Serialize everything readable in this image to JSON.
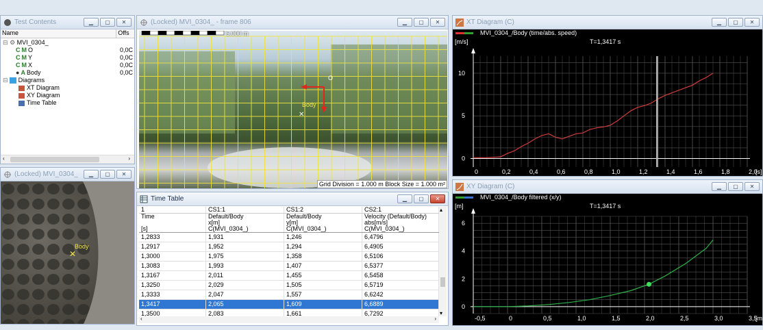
{
  "test_contents": {
    "title": "Test Contents",
    "col_name": "Name",
    "col_offset": "Offs",
    "root": "MVI_0304_",
    "items": [
      {
        "prefix": "C",
        "badge": "M",
        "label": "O",
        "value": "0,0C"
      },
      {
        "prefix": "C",
        "badge": "M",
        "label": "Y",
        "value": "0,0C"
      },
      {
        "prefix": "C",
        "badge": "M",
        "label": "X",
        "value": "0,0C"
      },
      {
        "prefix": "",
        "badge": "A",
        "label": "Body",
        "value": "0,0C"
      }
    ],
    "diagrams_label": "Diagrams",
    "diagram_items": [
      "XT Diagram",
      "XY Diagram",
      "Time Table"
    ]
  },
  "zoom_window": {
    "title": "(Locked) MVI_0304_",
    "marker_label": "Body"
  },
  "video_window": {
    "title": "(Locked) MVI_0304_ - frame 806",
    "scale_label": "5.000 m",
    "origin_label": "O",
    "body_label": "Body",
    "footer": "Grid Division = 1.000 m  Block Size = 1.000 m²"
  },
  "time_table": {
    "title": "Time Table",
    "headers": [
      {
        "l1": "1",
        "l2": "Time",
        "l3": "",
        "l4": "[s]"
      },
      {
        "l1": "CS1:1",
        "l2": "Default/Body",
        "l3": "x[m]",
        "l4": "C(MVI_0304_)"
      },
      {
        "l1": "CS1:2",
        "l2": "Default/Body",
        "l3": "y[m]",
        "l4": "C(MVI_0304_)"
      },
      {
        "l1": "CS2:1",
        "l2": "Velocity (Default/Body)",
        "l3": "abs[m/s]",
        "l4": "C(MVI_0304_)"
      }
    ],
    "rows": [
      [
        "1,2833",
        "1,931",
        "1,246",
        "6,4796"
      ],
      [
        "1,2917",
        "1,952",
        "1,294",
        "6,4905"
      ],
      [
        "1,3000",
        "1,975",
        "1,358",
        "6,5106"
      ],
      [
        "1,3083",
        "1,993",
        "1,407",
        "6,5377"
      ],
      [
        "1,3167",
        "2,011",
        "1,455",
        "6,5458"
      ],
      [
        "1,3250",
        "2,029",
        "1,505",
        "6,5719"
      ],
      [
        "1,3333",
        "2,047",
        "1,557",
        "6,6242"
      ],
      [
        "1,3417",
        "2,065",
        "1,609",
        "6,6889"
      ],
      [
        "1,3500",
        "2,083",
        "1,661",
        "6,7292"
      ]
    ],
    "selected_index": 7
  },
  "xt_diagram": {
    "title": "XT Diagram (C)",
    "legend": "MVI_0304_/Body (time/abs. speed)",
    "cursor": "T=1,3417 s",
    "accent": "#d23b3b"
  },
  "xy_diagram": {
    "title": "XY Diagram (C)",
    "legend": "MVI_0304_/Body filtered (x/y)",
    "cursor": "T=1,3417 s",
    "accent": "#2fb34a"
  },
  "chart_data": [
    {
      "type": "line",
      "title": "MVI_0304_/Body (time/abs. speed)",
      "ylabel": "[m/s]",
      "xlabel": "[s]",
      "xlim": [
        0,
        2.0
      ],
      "ylim": [
        -1,
        12
      ],
      "xticks": [
        "0",
        "0,2",
        "0,4",
        "0,6",
        "0,8",
        "1,0",
        "1,2",
        "1,4",
        "1,6",
        "1,8",
        "2,0"
      ],
      "yticks": [
        "0",
        "5",
        "10"
      ],
      "cursor_x": 1.3417,
      "series": [
        {
          "name": "MVI_0304_/Body",
          "color": "#d23b3b",
          "x": [
            0,
            0.1,
            0.2,
            0.25,
            0.3,
            0.35,
            0.4,
            0.45,
            0.5,
            0.55,
            0.6,
            0.65,
            0.7,
            0.75,
            0.8,
            0.85,
            0.9,
            0.95,
            1.0,
            1.05,
            1.1,
            1.15,
            1.2,
            1.25,
            1.3,
            1.35,
            1.4,
            1.45,
            1.5,
            1.55,
            1.6,
            1.65,
            1.7,
            1.75
          ],
          "y": [
            0.1,
            0.1,
            0.2,
            0.6,
            0.9,
            1.4,
            1.8,
            2.3,
            2.7,
            2.9,
            2.5,
            2.3,
            2.6,
            2.9,
            3.0,
            3.4,
            3.6,
            3.7,
            3.9,
            4.4,
            5.0,
            5.6,
            6.0,
            6.2,
            6.5,
            7.0,
            7.4,
            7.7,
            8.0,
            8.3,
            8.6,
            9.1,
            9.5,
            10.0
          ]
        }
      ]
    },
    {
      "type": "line",
      "title": "MVI_0304_/Body filtered (x/y)",
      "ylabel": "[m]",
      "xlabel": "[m]",
      "xlim": [
        -0.5,
        3.5
      ],
      "ylim": [
        -0.5,
        6.5
      ],
      "xticks": [
        "-0,5",
        "0",
        "0,5",
        "1,0",
        "1,5",
        "2,0",
        "2,5",
        "3,0",
        "3,5"
      ],
      "yticks": [
        "0",
        "2",
        "4",
        "6"
      ],
      "marker": {
        "x": 2.065,
        "y": 1.609
      },
      "series": [
        {
          "name": "MVI_0304_/Body filtered",
          "color": "#2fb34a",
          "x": [
            -0.5,
            0.0,
            0.3,
            0.6,
            0.9,
            1.2,
            1.5,
            1.8,
            2.065,
            2.3,
            2.6,
            2.9,
            3.0
          ],
          "y": [
            0.0,
            0.0,
            0.05,
            0.15,
            0.3,
            0.5,
            0.8,
            1.15,
            1.609,
            2.2,
            3.1,
            4.2,
            4.8
          ]
        }
      ]
    }
  ]
}
